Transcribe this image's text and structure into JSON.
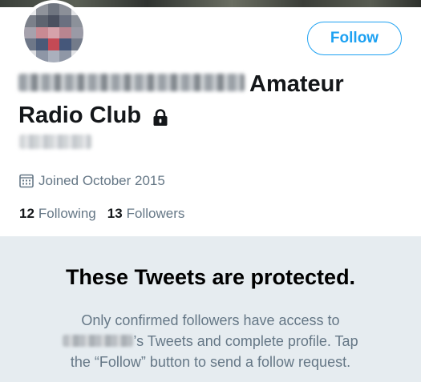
{
  "profile": {
    "name_suffix_line1": "Amateur",
    "name_line2": "Radio Club",
    "lock_icon": "lock-icon",
    "joined_icon": "calendar-icon",
    "joined_text": "Joined October 2015",
    "following_count": "12",
    "following_label": "Following",
    "followers_count": "13",
    "followers_label": "Followers"
  },
  "actions": {
    "follow_label": "Follow"
  },
  "protected": {
    "heading": "These Tweets are protected.",
    "line1": "Only confirmed followers have access to",
    "line2_suffix": "’s Tweets and complete profile. Tap",
    "line3": "the “Follow” button to send a follow request."
  },
  "colors": {
    "accent": "#1da1f2",
    "secondary_text": "#657786",
    "protected_bg": "#e6ecf0"
  }
}
